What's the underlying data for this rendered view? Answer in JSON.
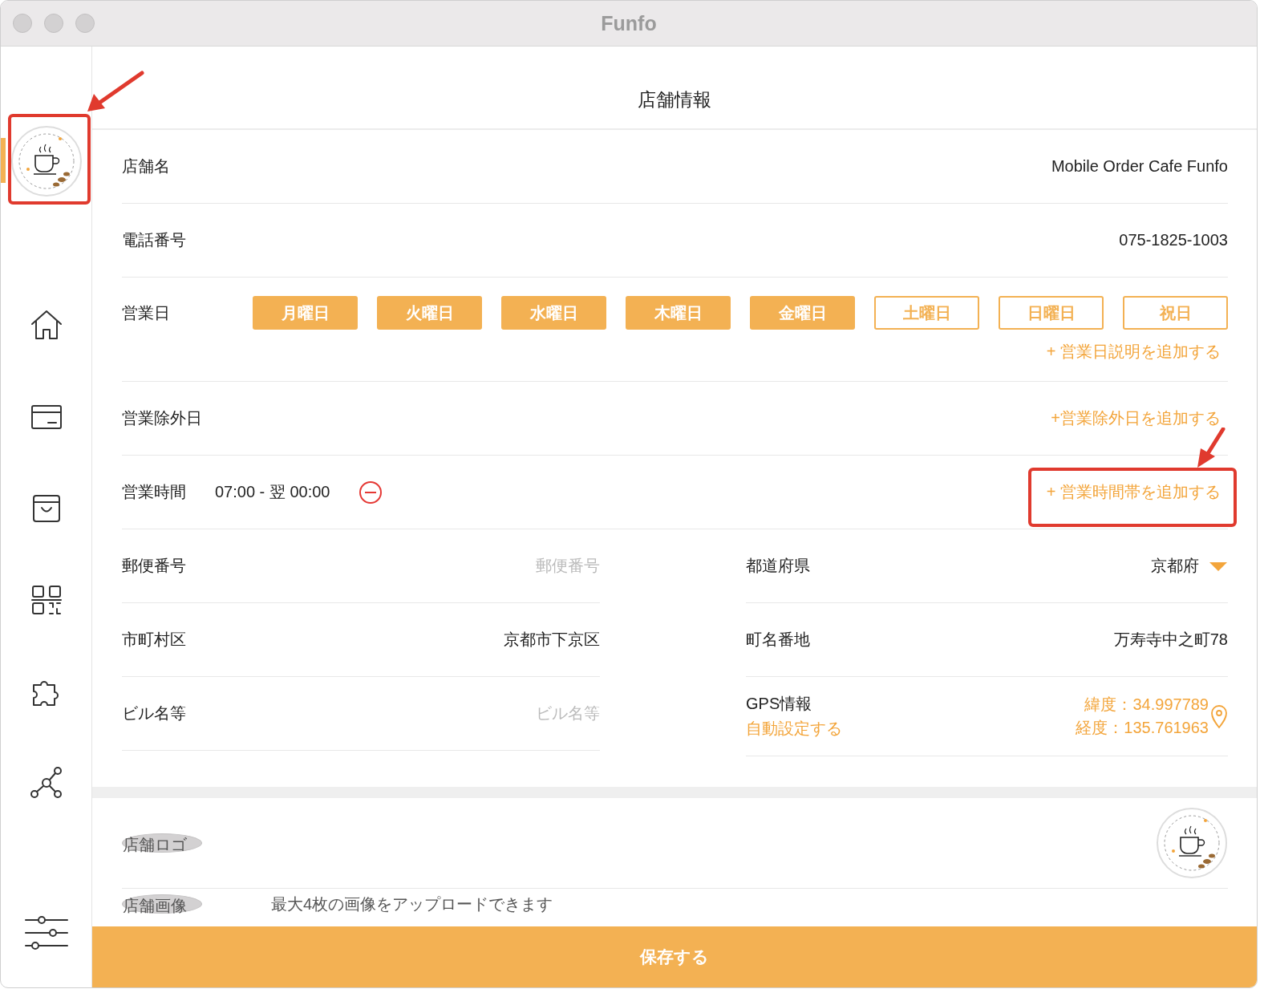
{
  "window": {
    "title": "Funfo"
  },
  "sidebar": {
    "items": [
      {
        "kind": "logo",
        "selected": true
      },
      {
        "kind": "home",
        "selected": false
      },
      {
        "kind": "card",
        "selected": false
      },
      {
        "kind": "bag",
        "selected": false
      },
      {
        "kind": "qr",
        "selected": false
      },
      {
        "kind": "puzzle",
        "selected": false
      },
      {
        "kind": "network",
        "selected": false
      },
      {
        "kind": "sliders",
        "selected": false
      }
    ]
  },
  "page_title": "店舗情報",
  "store_name": {
    "label": "店舗名",
    "value": "Mobile Order Cafe Funfo"
  },
  "phone": {
    "label": "電話番号",
    "value": "075-1825-1003"
  },
  "business_days": {
    "label": "営業日",
    "days": [
      {
        "label": "月曜日",
        "selected": true
      },
      {
        "label": "火曜日",
        "selected": true
      },
      {
        "label": "水曜日",
        "selected": true
      },
      {
        "label": "木曜日",
        "selected": true
      },
      {
        "label": "金曜日",
        "selected": true
      },
      {
        "label": "土曜日",
        "selected": false
      },
      {
        "label": "日曜日",
        "selected": false
      },
      {
        "label": "祝日",
        "selected": false
      }
    ],
    "add_link": "+ 営業日説明を追加する"
  },
  "closed_days": {
    "label": "営業除外日",
    "add_link": "+営業除外日を追加する"
  },
  "hours": {
    "label": "営業時間",
    "value": "07:00 - 翌 00:00",
    "add_link": "+ 営業時間帯を追加する"
  },
  "address": [
    {
      "label": "郵便番号",
      "placeholder": "郵便番号"
    },
    {
      "label": "都道府県",
      "value": "京都府",
      "kind": "dropdown"
    },
    {
      "label": "市町村区",
      "value": "京都市下京区"
    },
    {
      "label": "町名番地",
      "value": "万寿寺中之町78"
    },
    {
      "label": "ビル名等",
      "placeholder": "ビル名等"
    }
  ],
  "gps": {
    "label": "GPS情報",
    "auto_link": "自動設定する",
    "latitude": "緯度：34.997789",
    "longitude": "経度：135.761963"
  },
  "logo_row": {
    "label": "店舗ロゴ"
  },
  "images_row": {
    "label": "店舗画像",
    "hint": "最大4枚の画像をアップロードできます"
  },
  "save_button": "保存する",
  "annotations": [
    {
      "kind": "arrow"
    },
    {
      "kind": "frame"
    },
    {
      "kind": "arrow"
    },
    {
      "kind": "frame"
    }
  ]
}
